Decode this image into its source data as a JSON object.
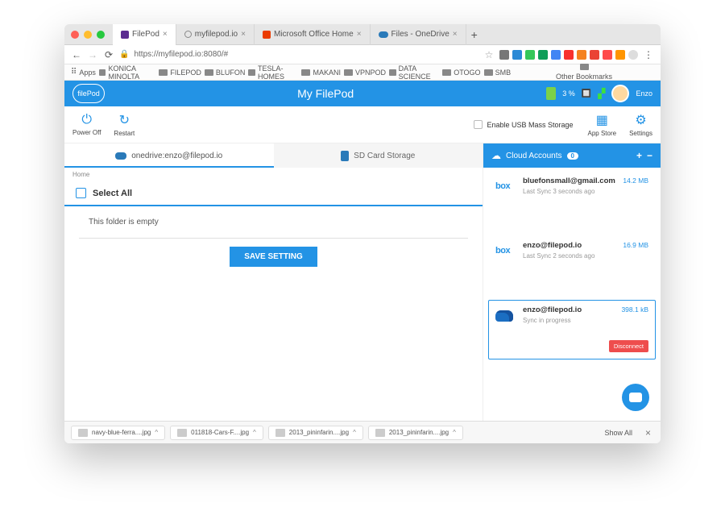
{
  "browser": {
    "tabs": [
      {
        "label": "FilePod",
        "active": true
      },
      {
        "label": "myfilepod.io"
      },
      {
        "label": "Microsoft Office Home"
      },
      {
        "label": "Files - OneDrive"
      }
    ],
    "url": "https://myfilepod.io:8080/#",
    "bookmarks": [
      "KONICA MINOLTA",
      "FILEPOD",
      "BLUFON",
      "TESLA-HOMES",
      "MAKANI",
      "VPNPOD",
      "DATA SCIENCE",
      "OTOGO",
      "SMB"
    ],
    "apps_label": "Apps",
    "other_bookmarks": "Other Bookmarks"
  },
  "header": {
    "logo_text": "filePod",
    "title": "My FilePod",
    "battery": "3 %",
    "username": "Enzo"
  },
  "toolbar": {
    "power_off": "Power Off",
    "restart": "Restart",
    "enable_usb": "Enable USB Mass Storage",
    "app_store": "App Store",
    "settings": "Settings"
  },
  "main_tabs": {
    "onedrive": "onedrive:enzo@filepod.io",
    "sdcard": "SD Card Storage"
  },
  "main": {
    "breadcrumb": "Home",
    "select_all": "Select All",
    "empty_msg": "This folder is empty",
    "save_btn": "SAVE SETTING"
  },
  "right": {
    "title": "Cloud Accounts",
    "count": "0",
    "accounts": [
      {
        "email": "bluefonsmall@gmail.com",
        "sync": "Last Sync 3 seconds ago",
        "size": "14.2 MB",
        "provider": "box"
      },
      {
        "email": "enzo@filepod.io",
        "sync": "Last Sync 2 seconds ago",
        "size": "16.9 MB",
        "provider": "box"
      },
      {
        "email": "enzo@filepod.io",
        "sync": "Sync in progress",
        "size": "398.1 kB",
        "provider": "onedrive",
        "selected": true,
        "disconnect": "Disconnect"
      }
    ]
  },
  "downloads": {
    "items": [
      "navy-blue-ferra....jpg",
      "011818-Cars-F....jpg",
      "2013_pininfarin....jpg",
      "2013_pininfarin....jpg"
    ],
    "show_all": "Show All"
  }
}
